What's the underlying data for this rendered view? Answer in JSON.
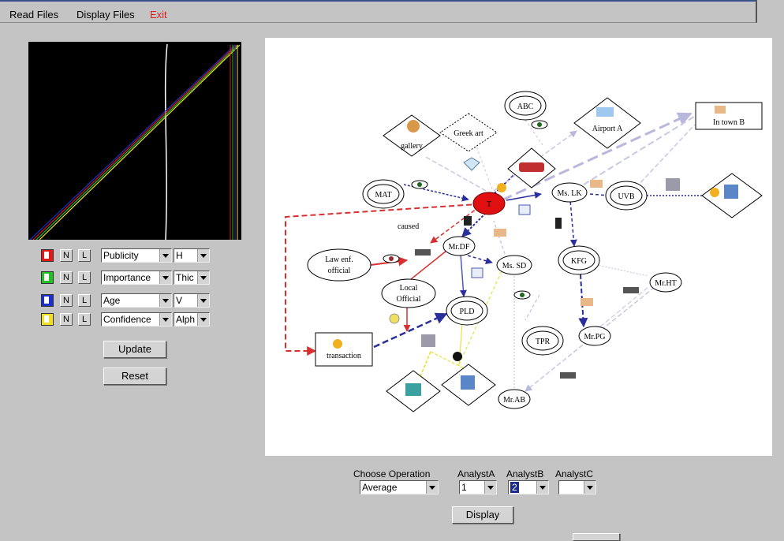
{
  "menu": {
    "read_files": "Read Files",
    "display_files": "Display Files",
    "exit": "Exit"
  },
  "controls": {
    "rows": [
      {
        "color": "#e01818",
        "n": "N",
        "l": "L",
        "attribute": "Publicity",
        "mode": "H"
      },
      {
        "color": "#22c022",
        "n": "N",
        "l": "L",
        "attribute": "Importance",
        "mode": "Thic"
      },
      {
        "color": "#1a2fcc",
        "n": "N",
        "l": "L",
        "attribute": "Age",
        "mode": "V"
      },
      {
        "color": "#f0e020",
        "n": "N",
        "l": "L",
        "attribute": "Confidence",
        "mode": "Alph"
      }
    ],
    "update": "Update",
    "reset": "Reset"
  },
  "graph": {
    "nodes": {
      "abc": "ABC",
      "airport": "Airport A",
      "in_town_b": "In town B",
      "greek_art": "Greek art",
      "gallery": "gallery",
      "mat": "MAT",
      "center": "T",
      "ms_lk": "Ms. LK",
      "uvb": "UVB",
      "law_line1": "Law enf.",
      "law_line2": "official",
      "mr_df": "Mr.DF",
      "ms_sd": "Ms. SD",
      "kfg": "KFG",
      "mr_ht": "Mr.HT",
      "local_line1": "Local",
      "local_line2": "Official",
      "pld": "PLD",
      "transaction": "transaction",
      "tpr": "TPR",
      "mr_pg": "Mr.PG",
      "mr_ab": "Mr.AB"
    },
    "edge_label": "caused"
  },
  "operation": {
    "label": "Choose Operation",
    "value": "Average",
    "analysts": [
      {
        "label": "AnalystA",
        "value": "1"
      },
      {
        "label": "AnalystB",
        "value": "2"
      },
      {
        "label": "AnalystC",
        "value": ""
      }
    ],
    "display": "Display"
  }
}
